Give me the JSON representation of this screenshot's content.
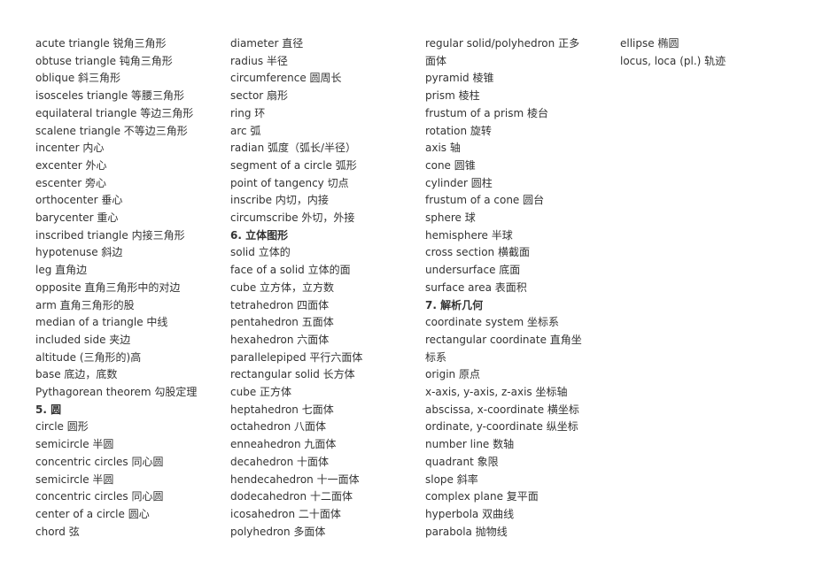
{
  "columns": [
    [
      {
        "text": "acute triangle 锐角三角形"
      },
      {
        "text": "obtuse triangle 钝角三角形"
      },
      {
        "text": "oblique 斜三角形"
      },
      {
        "text": "isosceles triangle 等腰三角形"
      },
      {
        "text": "equilateral triangle 等边三角形"
      },
      {
        "text": "scalene triangle 不等边三角形"
      },
      {
        "text": "incenter 内心"
      },
      {
        "text": "excenter 外心"
      },
      {
        "text": "escenter 旁心"
      },
      {
        "text": "orthocenter 垂心"
      },
      {
        "text": "barycenter 重心"
      },
      {
        "text": "inscribed triangle 内接三角形"
      },
      {
        "text": "hypotenuse 斜边"
      },
      {
        "text": "leg 直角边"
      },
      {
        "text": "opposite 直角三角形中的对边"
      },
      {
        "text": "arm 直角三角形的股"
      },
      {
        "text": "median of a triangle 中线"
      },
      {
        "text": "included side 夹边"
      },
      {
        "text": "altitude (三角形的)高"
      },
      {
        "text": "base 底边，底数"
      },
      {
        "text": "Pythagorean theorem 勾股定理"
      },
      {
        "text": "5. 圆",
        "heading": true
      },
      {
        "text": "circle 圆形"
      },
      {
        "text": "semicircle 半圆"
      },
      {
        "text": "concentric circles 同心圆"
      },
      {
        "text": "semicircle 半圆"
      },
      {
        "text": "concentric circles 同心圆"
      },
      {
        "text": "center of a circle 圆心"
      },
      {
        "text": "chord 弦"
      }
    ],
    [
      {
        "text": "diameter 直径"
      },
      {
        "text": "radius 半径"
      },
      {
        "text": "circumference 圆周长"
      },
      {
        "text": "sector 扇形"
      },
      {
        "text": "ring 环"
      },
      {
        "text": "arc 弧"
      },
      {
        "text": "radian 弧度（弧长/半径）"
      },
      {
        "text": "segment of a circle 弧形"
      },
      {
        "text": "point of tangency 切点"
      },
      {
        "text": "inscribe 内切，内接"
      },
      {
        "text": "circumscribe 外切，外接"
      },
      {
        "text": "6. 立体图形",
        "heading": true
      },
      {
        "text": "solid 立体的"
      },
      {
        "text": "face of a solid 立体的面"
      },
      {
        "text": "cube 立方体，立方数"
      },
      {
        "text": "tetrahedron 四面体"
      },
      {
        "text": "pentahedron 五面体"
      },
      {
        "text": "hexahedron 六面体"
      },
      {
        "text": "parallelepiped 平行六面体"
      },
      {
        "text": "rectangular solid 长方体"
      },
      {
        "text": "cube 正方体"
      },
      {
        "text": "heptahedron 七面体"
      },
      {
        "text": "octahedron 八面体"
      },
      {
        "text": "enneahedron 九面体"
      },
      {
        "text": "decahedron 十面体"
      },
      {
        "text": "hendecahedron 十一面体"
      },
      {
        "text": "dodecahedron 十二面体"
      },
      {
        "text": "icosahedron 二十面体"
      },
      {
        "text": "polyhedron 多面体"
      }
    ],
    [
      {
        "text": "regular solid/polyhedron 正多面体"
      },
      {
        "text": "pyramid 棱锥"
      },
      {
        "text": "prism 棱柱"
      },
      {
        "text": "frustum of a prism 棱台"
      },
      {
        "text": "rotation 旋转"
      },
      {
        "text": "axis 轴"
      },
      {
        "text": "cone 圆锥"
      },
      {
        "text": "cylinder 圆柱"
      },
      {
        "text": "frustum of a cone 圆台"
      },
      {
        "text": "sphere 球"
      },
      {
        "text": "hemisphere 半球"
      },
      {
        "text": "cross section 横截面"
      },
      {
        "text": "undersurface 底面"
      },
      {
        "text": "surface area 表面积"
      },
      {
        "text": "7. 解析几何",
        "heading": true
      },
      {
        "text": "coordinate system 坐标系"
      },
      {
        "text": "rectangular coordinate 直角坐标系"
      },
      {
        "text": "origin 原点"
      },
      {
        "text": "x-axis, y-axis, z-axis 坐标轴"
      },
      {
        "text": "abscissa, x-coordinate 横坐标"
      },
      {
        "text": "ordinate, y-coordinate 纵坐标"
      },
      {
        "text": "number line 数轴"
      },
      {
        "text": "quadrant 象限"
      },
      {
        "text": "slope 斜率"
      },
      {
        "text": "complex plane 复平面"
      },
      {
        "text": "hyperbola 双曲线"
      },
      {
        "text": "parabola 抛物线"
      }
    ],
    [
      {
        "text": "ellipse 椭圆"
      },
      {
        "text": "locus, loca (pl.) 轨迹"
      }
    ]
  ]
}
